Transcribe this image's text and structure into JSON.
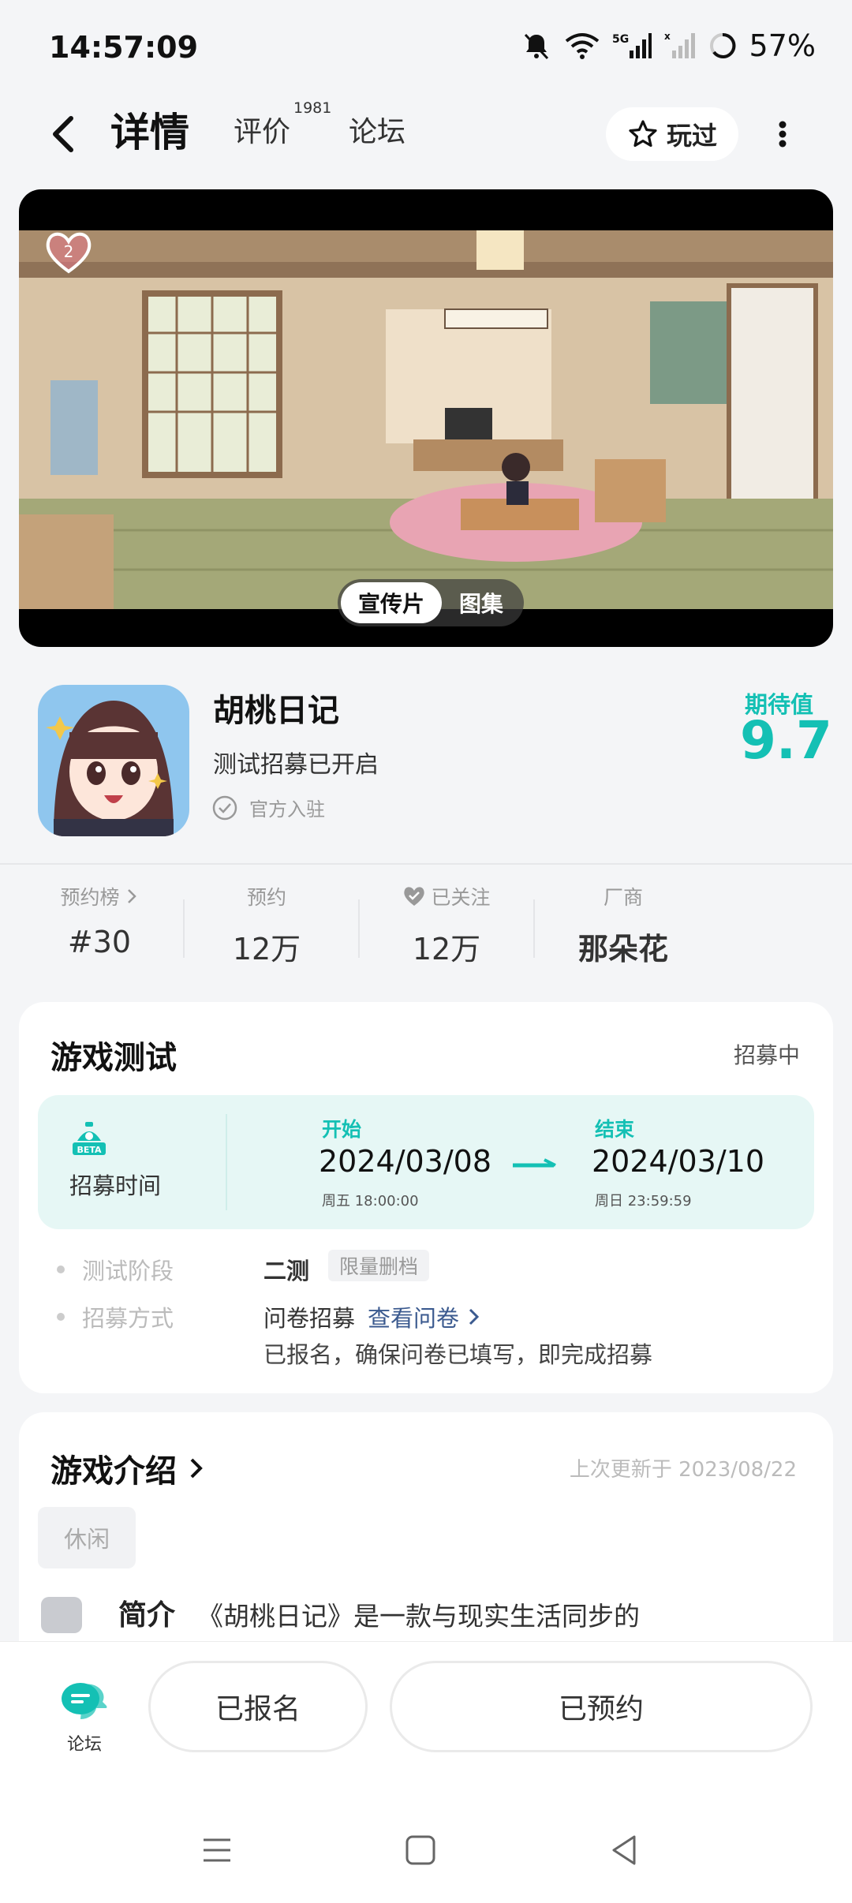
{
  "status_bar": {
    "time": "14:57:09",
    "battery": "57%",
    "icons": [
      "mute-bell-icon",
      "wifi-icon",
      "signal-5g-icon",
      "signal-icon",
      "battery-icon"
    ]
  },
  "nav": {
    "tabs": [
      {
        "label": "详情",
        "active": true
      },
      {
        "label": "评价",
        "badge": "1981"
      },
      {
        "label": "论坛"
      }
    ],
    "played_label": "玩过"
  },
  "media": {
    "like_count": "2",
    "tabs": [
      "宣传片",
      "图集"
    ]
  },
  "app": {
    "name": "胡桃日记",
    "subtitle": "测试招募已开启",
    "official": "官方入驻",
    "expect_label": "期待值",
    "expect_value": "9.7"
  },
  "stats": [
    {
      "label": "预约榜",
      "value": "#30"
    },
    {
      "label": "预约",
      "value": "12万"
    },
    {
      "label": "已关注",
      "value": "12万"
    },
    {
      "label": "厂商",
      "value": "那朵花"
    }
  ],
  "test": {
    "title": "游戏测试",
    "status": "招募中",
    "recruit_label": "招募时间",
    "start": {
      "label": "开始",
      "date": "2024/03/08",
      "sub": "周五  18:00:00"
    },
    "end": {
      "label": "结束",
      "date": "2024/03/10",
      "sub": "周日  23:59:59"
    },
    "phase_label": "测试阶段",
    "phase_value": "二测",
    "phase_tag": "限量删档",
    "method_label": "招募方式",
    "method_value": "问卷招募",
    "method_link": "查看问卷",
    "method_desc": "已报名，确保问卷已填写，即完成招募"
  },
  "intro": {
    "title": "游戏介绍",
    "updated": "上次更新于 2023/08/22",
    "tag": "休闲",
    "label": "简介",
    "text": "《胡桃日记》是一款与现实生活同步的"
  },
  "bottom": {
    "forum_label": "论坛",
    "signed_label": "已报名",
    "reserved_label": "已预约"
  },
  "colors": {
    "accent": "#14c0b4",
    "panel_bg": "#e6f7f5",
    "link": "#3b5a8f"
  }
}
